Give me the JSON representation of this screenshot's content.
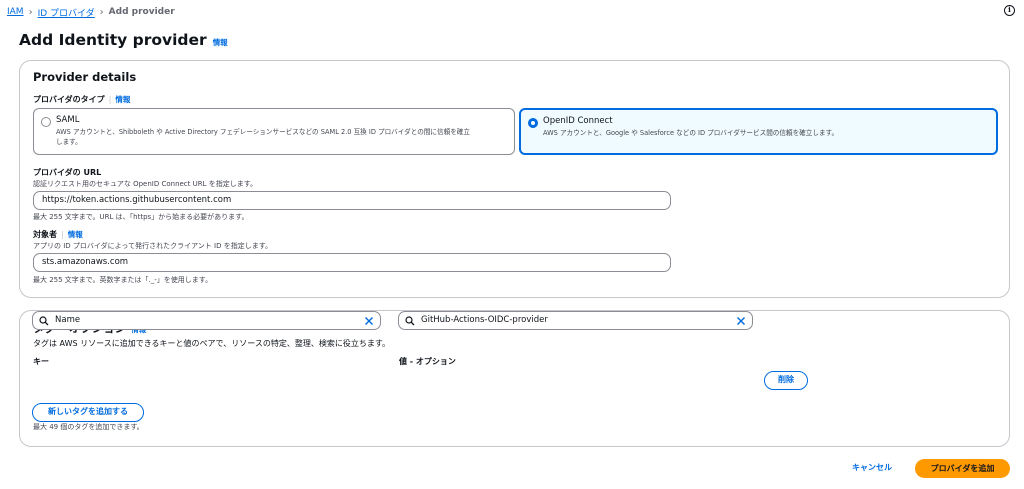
{
  "breadcrumb": {
    "items": [
      "IAM",
      "ID プロバイダ"
    ],
    "current": "Add provider"
  },
  "page": {
    "title": "Add Identity provider",
    "info": "情報"
  },
  "provider_details": {
    "heading": "Provider details",
    "type_label": "プロバイダのタイプ",
    "type_info": "情報",
    "options": [
      {
        "title": "SAML",
        "desc_line1": "AWS アカウントと、Shibboleth や Active Directory フェデレーションサービスなどの SAML 2.0 互換 ID プロバイダとの間に信頼を確立",
        "desc_line2": "します。",
        "selected": false
      },
      {
        "title": "OpenID Connect",
        "desc_line1": "AWS アカウントと、Google や Salesforce などの ID プロバイダサービス間の信頼を確立します。",
        "selected": true
      }
    ],
    "url_label": "プロバイダの URL",
    "url_desc": "認証リクエスト用のセキュアな OpenID Connect URL を指定します。",
    "url_value": "https://token.actions.githubusercontent.com",
    "url_hint": "最大 255 文字まで。URL は、「https」から始まる必要があります。",
    "audience_label": "対象者",
    "audience_info": "情報",
    "audience_desc": "アプリの ID プロバイダによって発行されたクライアント ID を指定します。",
    "audience_value": "sts.amazonaws.com",
    "audience_hint": "最大 255 文字まで。英数字または「._-」を使用します。"
  },
  "tags": {
    "heading": "タグ - オプション",
    "info": "情報",
    "desc": "タグは AWS リソースに追加できるキーと値のペアで、リソースの特定、整理、検索に役立ちます。",
    "key_label": "キー",
    "value_label": "値 - オプション",
    "key_value": "Name",
    "value_value": "GitHub-Actions-OIDC-provider",
    "remove_label": "削除",
    "add_label": "新しいタグを追加する",
    "limit_hint": "最大 49 個のタグを追加できます。"
  },
  "footer": {
    "cancel_label": "キャンセル",
    "submit_label": "プロバイダを追加"
  },
  "colors": {
    "accent": "#006ce0",
    "primary_button": "#ff9900",
    "selected_tile_bg": "#f0fbff",
    "border": "#c6c6cd"
  }
}
